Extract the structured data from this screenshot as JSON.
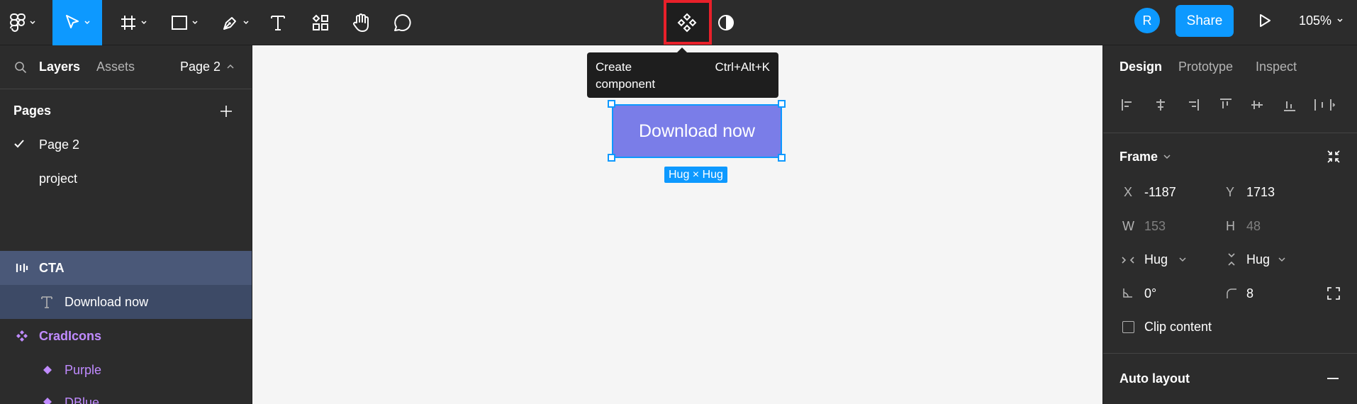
{
  "toolbar": {
    "share_label": "Share",
    "avatar_initial": "R",
    "zoom_label": "105%"
  },
  "tooltip": {
    "label": "Create component",
    "shortcut": "Ctrl+Alt+K"
  },
  "left_panel": {
    "tabs": {
      "layers": "Layers",
      "assets": "Assets",
      "page": "Page 2"
    },
    "pages_title": "Pages",
    "pages": [
      "Page 2",
      "project"
    ],
    "layers": [
      {
        "label": "CTA",
        "icon": "auto-layout-icon"
      },
      {
        "label": "Download now",
        "icon": "text-icon"
      },
      {
        "label": "CradIcons",
        "icon": "component-icon"
      },
      {
        "label": "Purple",
        "icon": "instance-icon"
      },
      {
        "label": "DBlue",
        "icon": "instance-icon"
      }
    ]
  },
  "canvas": {
    "button_label": "Download now",
    "size_tag": "Hug × Hug"
  },
  "right_panel": {
    "tabs": {
      "design": "Design",
      "prototype": "Prototype",
      "inspect": "Inspect"
    },
    "frame_title": "Frame",
    "x_label": "X",
    "x_value": "-1187",
    "y_label": "Y",
    "y_value": "1713",
    "w_label": "W",
    "w_value": "153",
    "h_label": "H",
    "h_value": "48",
    "hug_h": "Hug",
    "hug_v": "Hug",
    "rotation": "0°",
    "radius": "8",
    "clip_label": "Clip content",
    "auto_layout_title": "Auto layout"
  },
  "colors": {
    "accent": "#0d99ff",
    "button": "#7a7de8",
    "highlight": "#e8202a",
    "component": "#c08bff"
  }
}
